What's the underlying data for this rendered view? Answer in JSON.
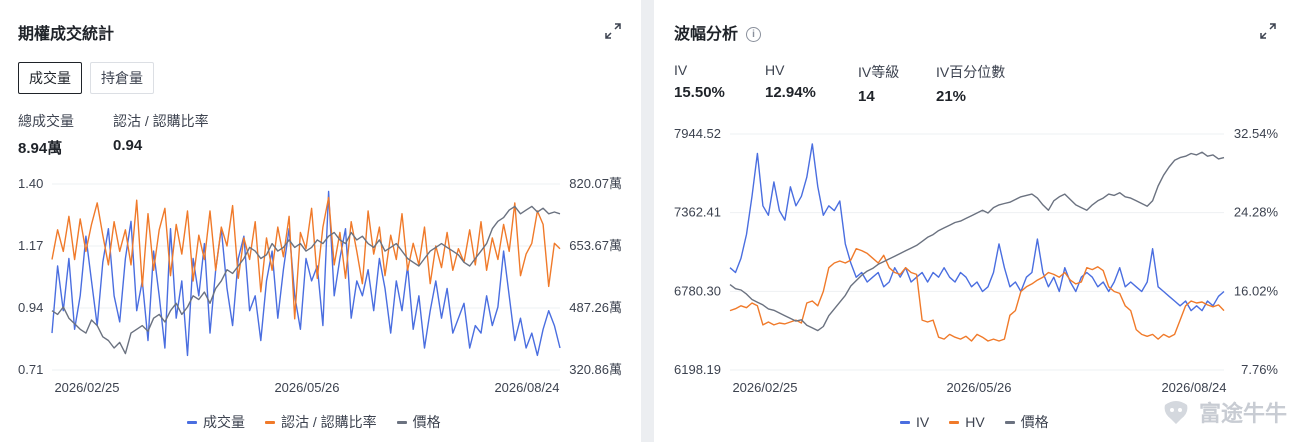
{
  "left": {
    "title": "期權成交統計",
    "tabs": [
      {
        "label": "成交量",
        "active": true
      },
      {
        "label": "持倉量",
        "active": false
      }
    ],
    "stats": [
      {
        "label": "總成交量",
        "value": "8.94萬"
      },
      {
        "label": "認沽 / 認購比率",
        "value": "0.94"
      }
    ]
  },
  "right": {
    "title": "波幅分析",
    "stats": [
      {
        "label": "IV",
        "value": "15.50%"
      },
      {
        "label": "HV",
        "value": "12.94%"
      },
      {
        "label": "IV等級",
        "value": "14"
      },
      {
        "label": "IV百分位數",
        "value": "21%"
      }
    ]
  },
  "watermark": "富途牛牛",
  "chart_data": [
    {
      "type": "line",
      "x_ticks": [
        "2026/02/25",
        "2026/05/26",
        "2026/08/24"
      ],
      "left_axis": {
        "ticks": [
          "1.40",
          "1.17",
          "0.94",
          "0.71"
        ],
        "range": [
          0.71,
          1.4
        ]
      },
      "right_axis": {
        "ticks": [
          "820.07萬",
          "653.67萬",
          "487.26萬",
          "320.86萬"
        ],
        "range": [
          320.86,
          820.07
        ]
      },
      "series": [
        {
          "name": "成交量",
          "axis": "right",
          "color": "#4a6ee0",
          "values": [
            420,
            600,
            480,
            620,
            430,
            520,
            680,
            560,
            440,
            610,
            700,
            520,
            450,
            620,
            720,
            480,
            560,
            400,
            640,
            520,
            380,
            700,
            460,
            560,
            360,
            620,
            520,
            660,
            420,
            590,
            700,
            540,
            440,
            620,
            680,
            480,
            520,
            400,
            560,
            640,
            460,
            590,
            700,
            520,
            430,
            620,
            560,
            600,
            440,
            800,
            520,
            620,
            700,
            460,
            560,
            520,
            590,
            480,
            620,
            540,
            420,
            560,
            480,
            600,
            430,
            520,
            380,
            480,
            560,
            460,
            540,
            420,
            460,
            500,
            380,
            440,
            420,
            520,
            440,
            490,
            640,
            520,
            400,
            460,
            380,
            420,
            360,
            430,
            480,
            440,
            380
          ]
        },
        {
          "name": "認沽 / 認購比率",
          "axis": "left",
          "color": "#f07a2a",
          "values": [
            1.12,
            1.23,
            1.15,
            1.28,
            1.12,
            1.27,
            1.15,
            1.25,
            1.33,
            1.21,
            1.1,
            1.26,
            1.15,
            1.23,
            1.1,
            1.34,
            1.02,
            1.29,
            1.08,
            1.23,
            1.31,
            1.06,
            1.25,
            1.14,
            1.3,
            1.04,
            1.21,
            1.12,
            1.3,
            1.08,
            1.24,
            1.17,
            1.32,
            1.05,
            1.2,
            1.12,
            1.26,
            1.0,
            1.2,
            1.08,
            1.24,
            1.13,
            1.28,
            0.9,
            1.22,
            1.16,
            1.31,
            1.05,
            1.24,
            1.35,
            1.1,
            1.22,
            1.05,
            1.26,
            1.15,
            1.03,
            1.3,
            1.14,
            1.24,
            1.06,
            1.21,
            1.12,
            1.29,
            1.08,
            1.18,
            1.1,
            1.24,
            1.03,
            1.17,
            1.09,
            1.22,
            1.08,
            1.16,
            1.11,
            1.23,
            1.1,
            1.26,
            1.08,
            1.2,
            1.12,
            1.25,
            1.15,
            1.33,
            1.06,
            1.14,
            1.18,
            1.3,
            1.25,
            1.02,
            1.18,
            1.16
          ]
        },
        {
          "name": "價格",
          "axis": "right",
          "color": "#6b7280",
          "values": [
            480,
            470,
            490,
            460,
            445,
            430,
            420,
            455,
            440,
            410,
            400,
            380,
            395,
            365,
            420,
            430,
            440,
            425,
            460,
            470,
            450,
            480,
            500,
            470,
            490,
            520,
            510,
            530,
            500,
            540,
            560,
            590,
            580,
            600,
            620,
            650,
            640,
            620,
            630,
            660,
            640,
            650,
            670,
            650,
            660,
            640,
            650,
            670,
            660,
            680,
            690,
            670,
            660,
            690,
            670,
            680,
            660,
            650,
            670,
            640,
            650,
            660,
            640,
            620,
            610,
            600,
            620,
            640,
            650,
            660,
            650,
            640,
            630,
            610,
            600,
            620,
            640,
            660,
            700,
            720,
            730,
            750,
            760,
            740,
            750,
            760,
            745,
            755,
            740,
            745,
            740
          ]
        }
      ]
    },
    {
      "type": "line",
      "x_ticks": [
        "2026/02/25",
        "2026/05/26",
        "2026/08/24"
      ],
      "left_axis": {
        "ticks": [
          "7944.52",
          "7362.41",
          "6780.30",
          "6198.19"
        ],
        "range": [
          6198.19,
          7944.52
        ]
      },
      "right_axis": {
        "ticks": [
          "32.54%",
          "24.28%",
          "16.02%",
          "7.76%"
        ],
        "range": [
          7.76,
          32.54
        ]
      },
      "series": [
        {
          "name": "IV",
          "axis": "right",
          "color": "#4a6ee0",
          "values": [
            18.5,
            18.0,
            19.5,
            22.0,
            26.0,
            30.5,
            25.0,
            24.0,
            27.5,
            24.5,
            23.5,
            27.0,
            25.0,
            26.0,
            28.0,
            31.5,
            27.0,
            24.0,
            25.0,
            24.5,
            25.5,
            21.0,
            19.0,
            17.5,
            18.0,
            17.0,
            17.5,
            18.0,
            16.5,
            17.0,
            18.5,
            17.5,
            18.5,
            17.0,
            17.5,
            18.0,
            17.0,
            18.0,
            17.5,
            18.5,
            17.5,
            17.0,
            18.0,
            17.5,
            16.5,
            17.0,
            16.0,
            16.5,
            18.0,
            21.0,
            18.5,
            16.5,
            17.0,
            16.0,
            17.5,
            18.0,
            21.5,
            18.0,
            16.5,
            17.5,
            16.0,
            18.5,
            17.0,
            16.0,
            17.5,
            18.0,
            17.5,
            16.5,
            17.0,
            16.0,
            17.0,
            18.5,
            16.5,
            17.0,
            16.5,
            16.0,
            17.0,
            20.5,
            16.5,
            16.0,
            15.5,
            15.0,
            14.5,
            15.0,
            14.0,
            14.5,
            14.0,
            15.0,
            14.5,
            15.5,
            16.0
          ]
        },
        {
          "name": "HV",
          "axis": "right",
          "color": "#f07a2a",
          "values": [
            14.0,
            14.2,
            14.5,
            14.3,
            14.8,
            14.5,
            12.5,
            12.8,
            12.5,
            12.7,
            12.6,
            12.8,
            13.0,
            12.7,
            14.8,
            15.0,
            14.5,
            16.0,
            18.5,
            19.0,
            19.2,
            19.0,
            19.3,
            20.5,
            20.3,
            20.0,
            19.5,
            19.0,
            19.8,
            18.5,
            18.0,
            17.8,
            18.5,
            18.0,
            17.8,
            13.0,
            12.8,
            13.0,
            11.2,
            11.0,
            11.5,
            11.2,
            11.0,
            11.3,
            10.8,
            11.5,
            11.2,
            10.8,
            11.0,
            10.8,
            11.0,
            13.5,
            14.0,
            16.0,
            16.5,
            16.8,
            17.2,
            17.5,
            18.0,
            17.8,
            17.5,
            18.0,
            17.2,
            16.8,
            17.0,
            18.5,
            18.3,
            18.6,
            18.2,
            16.5,
            16.0,
            15.8,
            14.5,
            14.0,
            12.0,
            11.5,
            11.3,
            11.5,
            11.0,
            11.5,
            11.2,
            11.5,
            13.0,
            14.5,
            15.0,
            14.8,
            14.9,
            14.6,
            14.4,
            14.6,
            14.0
          ]
        },
        {
          "name": "價格",
          "axis": "left",
          "color": "#6b7280",
          "values": [
            6830,
            6800,
            6790,
            6760,
            6720,
            6700,
            6680,
            6650,
            6640,
            6620,
            6600,
            6580,
            6560,
            6570,
            6530,
            6510,
            6490,
            6520,
            6600,
            6650,
            6700,
            6750,
            6820,
            6860,
            6900,
            6930,
            6950,
            6980,
            7000,
            7020,
            7040,
            7060,
            7080,
            7100,
            7120,
            7150,
            7180,
            7200,
            7230,
            7250,
            7270,
            7290,
            7300,
            7320,
            7340,
            7360,
            7380,
            7360,
            7400,
            7420,
            7430,
            7440,
            7460,
            7480,
            7490,
            7500,
            7470,
            7420,
            7380,
            7450,
            7480,
            7500,
            7460,
            7420,
            7400,
            7380,
            7420,
            7450,
            7470,
            7500,
            7490,
            7510,
            7480,
            7470,
            7450,
            7430,
            7410,
            7450,
            7560,
            7640,
            7700,
            7750,
            7770,
            7780,
            7800,
            7790,
            7810,
            7780,
            7790,
            7760,
            7770
          ]
        }
      ]
    }
  ]
}
